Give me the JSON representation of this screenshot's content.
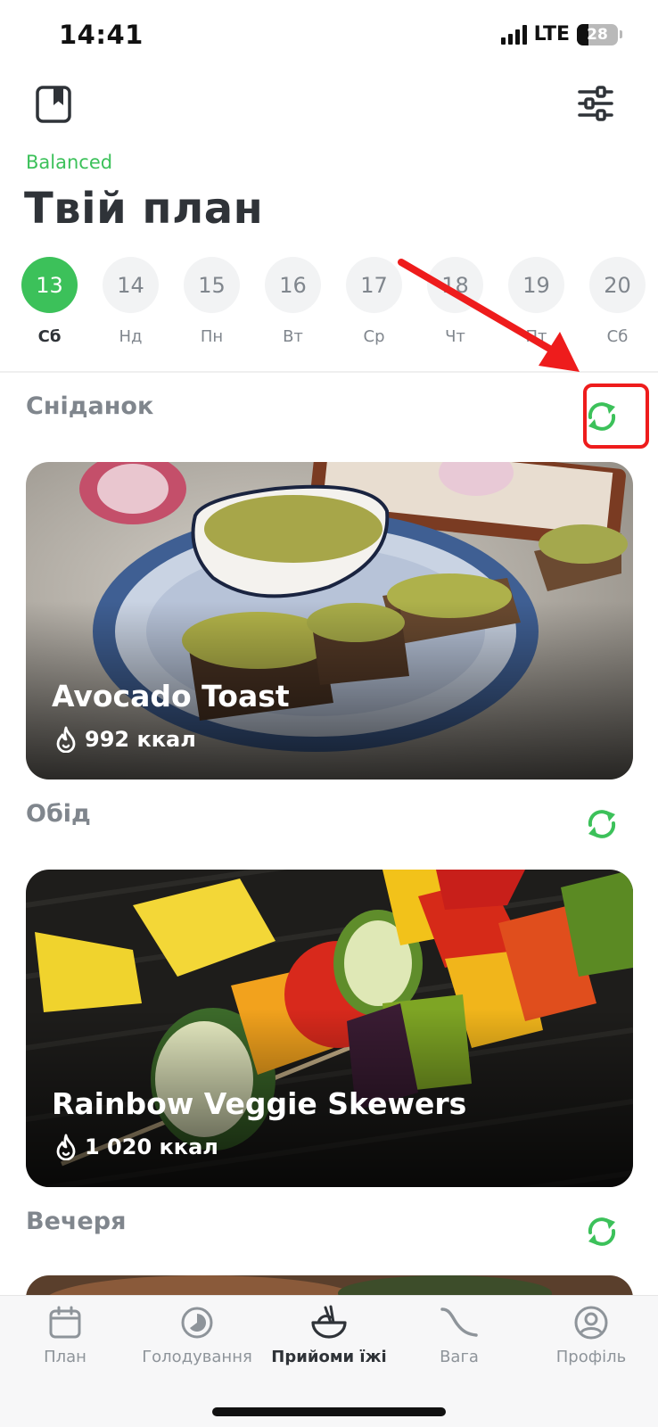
{
  "status_bar": {
    "time": "14:41",
    "network": "LTE",
    "battery": "28"
  },
  "header": {
    "subtitle": "Balanced",
    "title": "Твій план"
  },
  "days": [
    {
      "num": "13",
      "name": "Сб",
      "active": true
    },
    {
      "num": "14",
      "name": "Нд",
      "active": false
    },
    {
      "num": "15",
      "name": "Пн",
      "active": false
    },
    {
      "num": "16",
      "name": "Вт",
      "active": false
    },
    {
      "num": "17",
      "name": "Ср",
      "active": false
    },
    {
      "num": "18",
      "name": "Чт",
      "active": false
    },
    {
      "num": "19",
      "name": "Пт",
      "active": false
    },
    {
      "num": "20",
      "name": "Сб",
      "active": false
    }
  ],
  "meals": [
    {
      "label": "Сніданок",
      "dish": "Avocado Toast",
      "kcal": "992 ккал"
    },
    {
      "label": "Обід",
      "dish": "Rainbow Veggie Skewers",
      "kcal": "1 020 ккал"
    },
    {
      "label": "Вечеря"
    }
  ],
  "tabs": [
    {
      "label": "План",
      "icon": "calendar-icon"
    },
    {
      "label": "Голодування",
      "icon": "fasting-timer-icon"
    },
    {
      "label": "Прийоми їжі",
      "icon": "bowl-icon",
      "active": true
    },
    {
      "label": "Вага",
      "icon": "weight-curve-icon"
    },
    {
      "label": "Профіль",
      "icon": "profile-icon"
    }
  ],
  "colors": {
    "accent": "#3cc15a",
    "annotation": "#ee1c1c",
    "text_dark": "#2f3338",
    "text_muted": "#80868d"
  }
}
